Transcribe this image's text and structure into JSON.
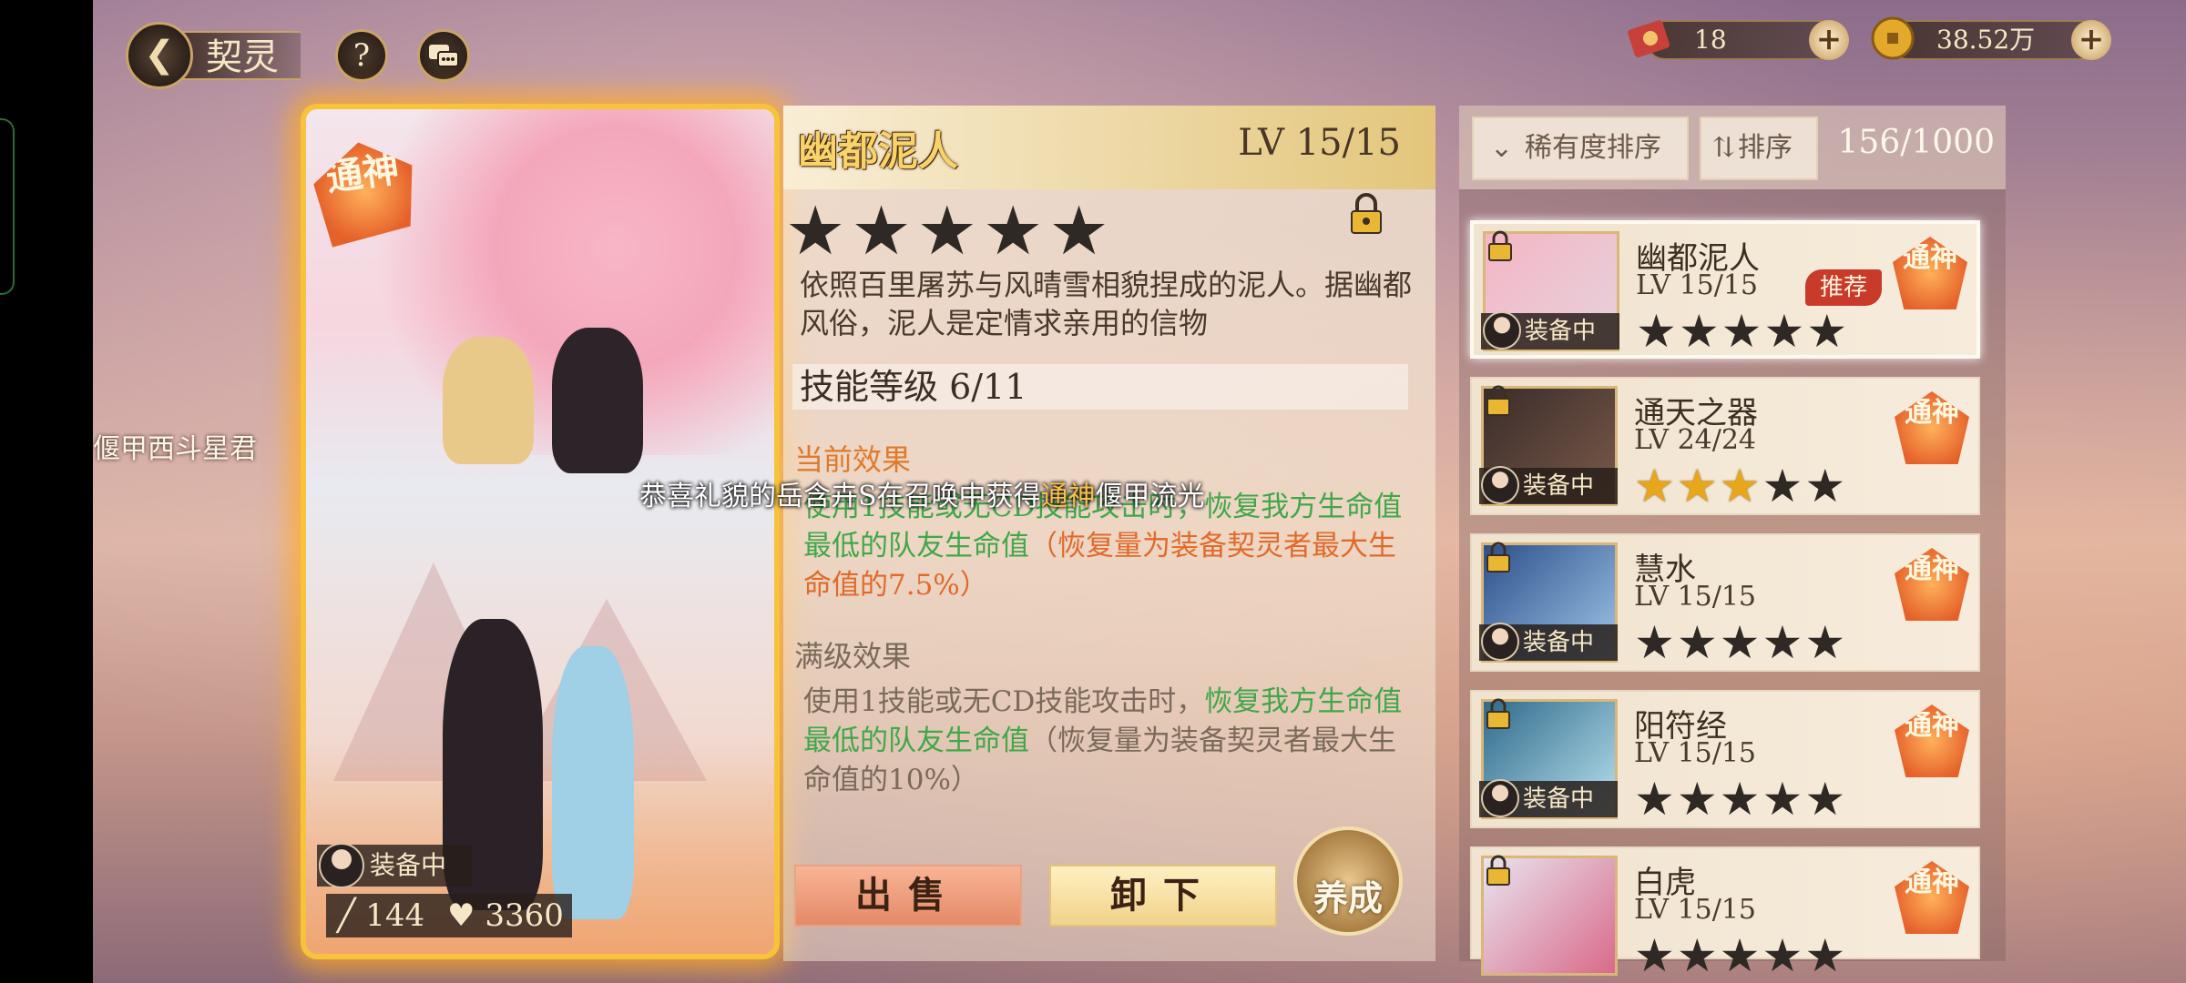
{
  "header": {
    "back_icon": "back-arrow-icon",
    "title": "契灵",
    "help_symbol": "?",
    "chat_icon": "chat-bubbles-icon"
  },
  "currencies": [
    {
      "icon": "ticket-icon",
      "value": "18"
    },
    {
      "icon": "coin-icon",
      "value": "38.52万"
    }
  ],
  "card": {
    "rank_badge": "通神",
    "equipped_label": "装备中",
    "attack": "144",
    "health": "3360"
  },
  "details": {
    "name": "幽都泥人",
    "level": "LV 15/15",
    "stars": "★★★★★",
    "description": "依照百里屠苏与风晴雪相貌捏成的泥人。据幽都风俗，泥人是定情求亲用的信物",
    "skill_level": "技能等级 6/11",
    "current_effect_title": "当前效果",
    "current_effect": {
      "part1": "使用1技能或无CD技能攻击时，",
      "part2": "恢复我方生命值最低的队友生命值",
      "part3": "（恢复量为装备契灵者最大生命值的7.5%）"
    },
    "max_effect_title": "满级效果",
    "max_effect": {
      "part1": "使用1技能或无CD技能攻击时，",
      "part2": "恢复我方生命值最低的队友生命值",
      "part3": "（恢复量为装备契灵者最大生命值的10%）"
    },
    "sell_label": "出售",
    "unequip_label": "卸下",
    "develop_label": "养成"
  },
  "list": {
    "sort_rarity_label": "稀有度排序",
    "sort_label": "排序",
    "count": "156/1000",
    "items": [
      {
        "name": "幽都泥人",
        "level": "LV 15/15",
        "gold_stars": 0,
        "equipped": "装备中",
        "badge": "通神",
        "recommend": "推荐",
        "selected": true
      },
      {
        "name": "通天之器",
        "level": "LV 24/24",
        "gold_stars": 3,
        "equipped": "装备中",
        "badge": "通神"
      },
      {
        "name": "慧水",
        "level": "LV 15/15",
        "gold_stars": 0,
        "equipped": "装备中",
        "badge": "通神"
      },
      {
        "name": "阳符经",
        "level": "LV 15/15",
        "gold_stars": 0,
        "equipped": "装备中",
        "badge": "通神"
      },
      {
        "name": "白虎",
        "level": "LV 15/15",
        "gold_stars": 0,
        "equipped": "",
        "badge": "通神"
      }
    ]
  },
  "overlay": {
    "side_name": "偃甲西斗星君",
    "marquee_prefix": "恭喜礼貌的岳含卉S在召唤中获得",
    "marquee_highlight": "通神",
    "marquee_suffix": "偃甲流光"
  },
  "colors": {
    "card_border": "#f6c33a",
    "effect_green": "#41a74a",
    "effect_orange": "#e06a2a",
    "recommend_red": "#c83a2a"
  }
}
